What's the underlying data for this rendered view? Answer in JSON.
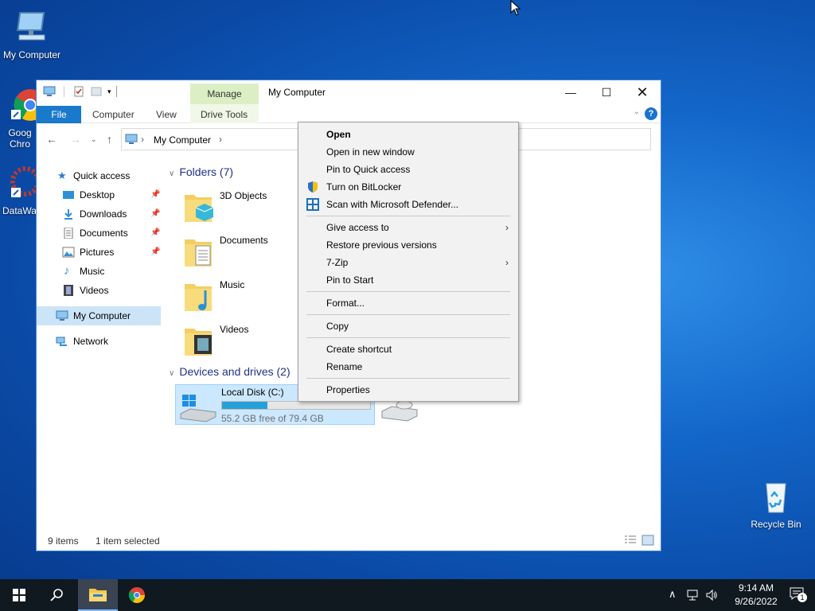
{
  "desktop": {
    "icons": [
      {
        "label": "My Computer"
      },
      {
        "label": "Goog Chro"
      },
      {
        "label": "DataWa"
      },
      {
        "label": "Recycle Bin"
      }
    ]
  },
  "window": {
    "title": "My Computer",
    "manage_tab": "Manage",
    "ribbon_tabs": [
      "File",
      "Computer",
      "View",
      "Drive Tools"
    ],
    "address": "My Computer"
  },
  "nav": {
    "items": [
      {
        "label": "Quick access"
      },
      {
        "label": "Desktop"
      },
      {
        "label": "Downloads"
      },
      {
        "label": "Documents"
      },
      {
        "label": "Pictures"
      },
      {
        "label": "Music"
      },
      {
        "label": "Videos"
      },
      {
        "label": "My Computer"
      },
      {
        "label": "Network"
      }
    ]
  },
  "content": {
    "folders_header": "Folders (7)",
    "folders": [
      "3D Objects",
      "Documents",
      "Music",
      "Videos"
    ],
    "devices_header": "Devices and drives (2)",
    "drive": {
      "name": "Local Disk (C:)",
      "free_text": "55.2 GB free of 79.4 GB",
      "used_fraction": 0.305
    }
  },
  "status": {
    "items": "9 items",
    "selected": "1 item selected"
  },
  "context_menu": {
    "items": [
      {
        "label": "Open"
      },
      {
        "label": "Open in new window"
      },
      {
        "label": "Pin to Quick access"
      },
      {
        "label": "Turn on BitLocker"
      },
      {
        "label": "Scan with Microsoft Defender..."
      },
      {
        "label": "Give access to"
      },
      {
        "label": "Restore previous versions"
      },
      {
        "label": "7-Zip"
      },
      {
        "label": "Pin to Start"
      },
      {
        "label": "Format..."
      },
      {
        "label": "Copy"
      },
      {
        "label": "Create shortcut"
      },
      {
        "label": "Rename"
      },
      {
        "label": "Properties"
      }
    ]
  },
  "taskbar": {
    "time": "9:14 AM",
    "date": "9/26/2022",
    "notification_count": "1"
  },
  "colors": {
    "accent": "#1979ca",
    "selection": "#cce8ff",
    "taskbar": "#101820"
  }
}
